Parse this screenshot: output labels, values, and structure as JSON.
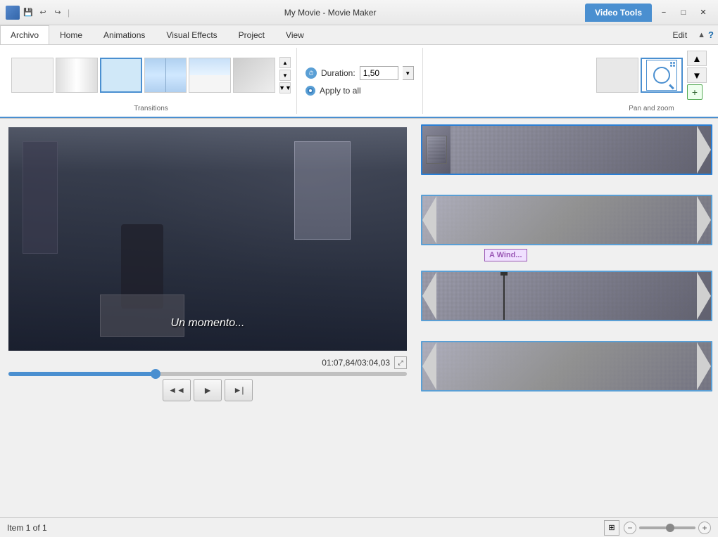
{
  "titleBar": {
    "title": "My Movie - Movie Maker",
    "videoToolsLabel": "Video Tools",
    "minimizeLabel": "−",
    "maximizeLabel": "□",
    "closeLabel": "✕"
  },
  "ribbon": {
    "tabs": [
      {
        "id": "archivo",
        "label": "Archivo",
        "active": true
      },
      {
        "id": "home",
        "label": "Home"
      },
      {
        "id": "animations",
        "label": "Animations"
      },
      {
        "id": "visualEffects",
        "label": "Visual Effects"
      },
      {
        "id": "project",
        "label": "Project"
      },
      {
        "id": "view",
        "label": "View"
      },
      {
        "id": "edit",
        "label": "Edit"
      }
    ],
    "transitions": {
      "sectionLabel": "Transitions",
      "items": [
        {
          "id": "blank1",
          "style": "blank"
        },
        {
          "id": "fade",
          "style": "fade"
        },
        {
          "id": "dissolve",
          "style": "dissolve",
          "selected": true
        },
        {
          "id": "wipe",
          "style": "wipe"
        },
        {
          "id": "corner",
          "style": "corner"
        },
        {
          "id": "blank2",
          "style": "blank2"
        }
      ]
    },
    "duration": {
      "label": "Duration:",
      "value": "1,50",
      "applyLabel": "Apply to all"
    },
    "panZoom": {
      "sectionLabel": "Pan and zoom",
      "items": [
        {
          "id": "pz1",
          "style": "blank"
        },
        {
          "id": "pz2",
          "style": "selected"
        }
      ]
    }
  },
  "preview": {
    "subtitle": "Un momento...",
    "timeDisplay": "01:07,84/03:04,03",
    "progressPercent": 37
  },
  "controls": {
    "rewindLabel": "◄◄",
    "playLabel": "►",
    "forwardLabel": "►|"
  },
  "timeline": {
    "clips": [
      {
        "id": "clip1",
        "hasThumb": true
      },
      {
        "id": "clip2",
        "hasLabel": true,
        "labelText": "A Wind..."
      },
      {
        "id": "clip3",
        "hasPlayhead": true
      },
      {
        "id": "clip4"
      }
    ]
  },
  "statusBar": {
    "itemInfo": "Item 1 of 1",
    "zoomMinus": "−",
    "zoomPlus": "+"
  }
}
